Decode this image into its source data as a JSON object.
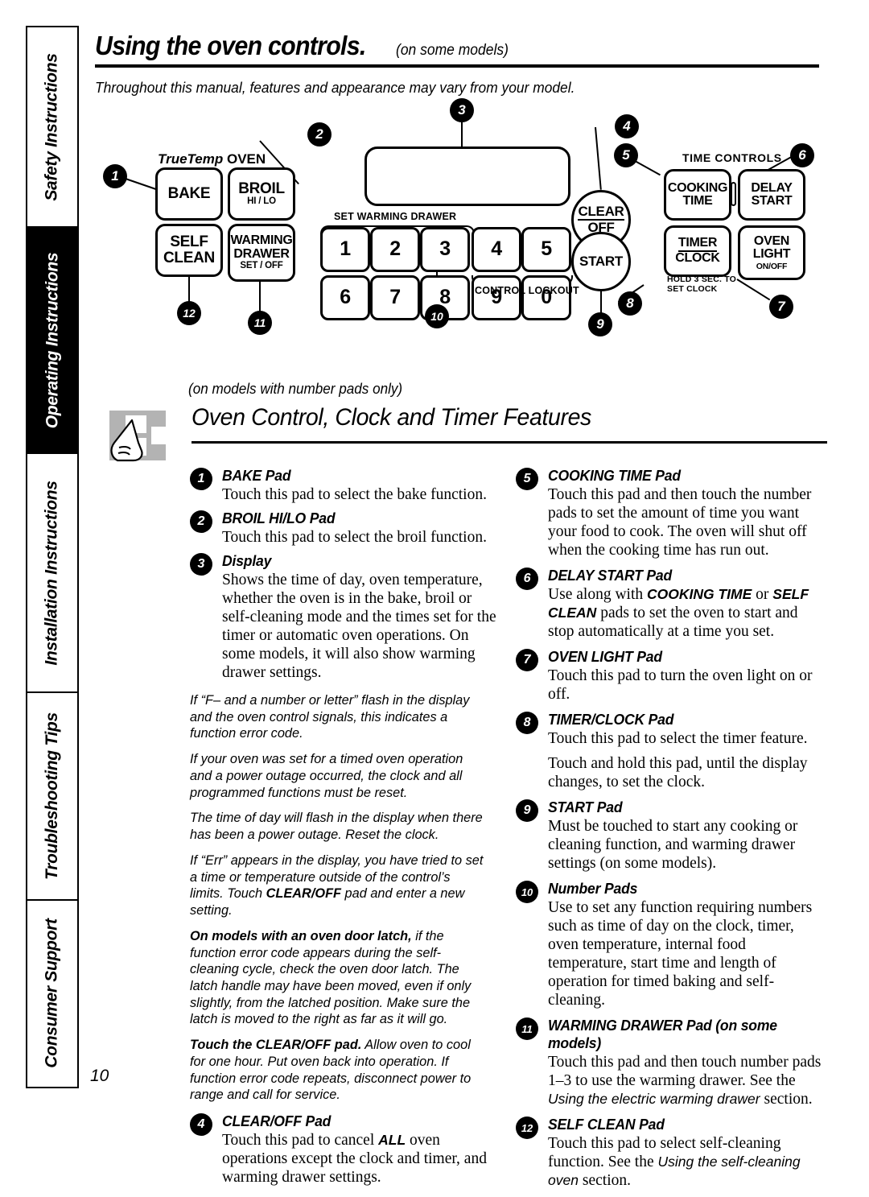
{
  "sidebar": {
    "tabs": [
      {
        "label": "Safety Instructions",
        "active": false,
        "flex": 1.55
      },
      {
        "label": "Operating Instructions",
        "active": true,
        "flex": 1.75
      },
      {
        "label": "Installation Instructions",
        "active": false,
        "flex": 1.85
      },
      {
        "label": "Troubleshooting Tips",
        "active": false,
        "flex": 1.6
      },
      {
        "label": "Consumer Support",
        "active": false,
        "flex": 1.45
      }
    ]
  },
  "header": {
    "title": "Using the oven controls.",
    "subtitle": "(on some models)",
    "intro": "Throughout this manual, features and appearance may vary from your model."
  },
  "diagram": {
    "brand_true_temp": "TrueTemp",
    "brand_oven": "OVEN",
    "set_warming_drawer_label": "SET WARMING DRAWER",
    "control_lockout_label": "CONTROL LOCKOUT",
    "time_controls_label": "TIME CONTROLS",
    "hold_clock_label_1": "HOLD 3 SEC. TO",
    "hold_clock_label_2": "SET CLOCK",
    "caption": "(on models with number pads only)",
    "pads": {
      "bake": "BAKE",
      "broil": "BROIL",
      "broil_sub": "HI / LO",
      "self": "SELF",
      "clean": "CLEAN",
      "warming": "WARMING",
      "drawer": "DRAWER",
      "drawer_sub": "SET / OFF",
      "clear": "CLEAR",
      "off": "OFF",
      "start": "START",
      "cooking": "COOKING",
      "time": "TIME",
      "delay": "DELAY",
      "delay_start": "START",
      "timer": "TIMER",
      "clock": "CLOCK",
      "oven": "OVEN",
      "light": "LIGHT",
      "light_sub": "ON/OFF"
    },
    "number_pads_row1": [
      "1",
      "2",
      "3",
      "4",
      "5"
    ],
    "number_pads_row2": [
      "6",
      "7",
      "8",
      "9",
      "0"
    ],
    "callouts": [
      "1",
      "2",
      "3",
      "4",
      "5",
      "6",
      "7",
      "8",
      "9",
      "10",
      "11",
      "12"
    ]
  },
  "section": {
    "title": "Oven Control, Clock and Timer Features"
  },
  "left_column": {
    "entries_top": [
      {
        "num": "1",
        "heading": "BAKE Pad",
        "body": [
          "Touch this pad to select the bake function."
        ]
      },
      {
        "num": "2",
        "heading": "BROIL HI/LO Pad",
        "body": [
          "Touch this pad to select the broil function."
        ]
      },
      {
        "num": "3",
        "heading": "Display",
        "body": [
          "Shows the time of day, oven temperature, whether the oven is in the bake, broil or self-cleaning mode and the times set for the timer or automatic oven operations. On some models, it will also show warming drawer settings."
        ]
      }
    ],
    "notes": [
      {
        "bold": "",
        "text": "If “F– and a number or letter” flash in the display and the oven control signals, this indicates a function error code."
      },
      {
        "bold": "",
        "text": "If your oven was set for a timed oven operation and a power outage occurred, the clock and all programmed functions must be reset."
      },
      {
        "bold": "",
        "text": "The time of day will flash in the display when there has been a power outage. Reset the clock."
      },
      {
        "bold": "",
        "text": "If “Err” appears in the display, you have tried to set a time or temperature outside of the control’s limits. Touch CLEAR/OFF pad and enter a new setting."
      },
      {
        "bold": "On models with an oven door latch,",
        "text": " if the function error code appears during the self-cleaning cycle, check the oven door latch. The latch handle may have been moved, even if only slightly, from the latched position. Make sure the latch is moved to the right as far as it will go."
      },
      {
        "bold": "Touch the CLEAR/OFF pad.",
        "text": " Allow oven to cool for one hour. Put oven back into operation. If function error code repeats, disconnect power to range and call for service."
      }
    ],
    "entry_bottom": {
      "num": "4",
      "heading": "CLEAR/OFF Pad",
      "body": "Touch this pad to cancel ALL oven operations except the clock and timer, and warming drawer settings."
    }
  },
  "right_column": {
    "entries": [
      {
        "num": "5",
        "heading": "COOKING TIME Pad",
        "body": [
          "Touch this pad and then touch the number pads to set the amount of time you want your food to cook. The oven will shut off when the cooking time has run out."
        ]
      },
      {
        "num": "6",
        "heading": "DELAY START Pad",
        "body": [
          "Use along with COOKING TIME or SELF CLEAN pads to set the oven to start and stop automatically at a time you set."
        ]
      },
      {
        "num": "7",
        "heading": "OVEN LIGHT Pad",
        "body": [
          "Touch this pad to turn the oven light on or off."
        ]
      },
      {
        "num": "8",
        "heading": "TIMER/CLOCK Pad",
        "body": [
          "Touch this pad to select the timer feature.",
          "Touch and hold this pad, until the display changes, to set the clock."
        ]
      },
      {
        "num": "9",
        "heading": "START Pad",
        "body": [
          "Must be touched to start any cooking or cleaning function, and warming drawer settings (on some models)."
        ]
      },
      {
        "num": "10",
        "heading": "Number Pads",
        "body": [
          "Use to set any function requiring numbers such as time of day on the clock, timer, oven temperature, internal food temperature, start time and length of operation for timed baking and self-cleaning."
        ]
      },
      {
        "num": "11",
        "heading": "WARMING DRAWER Pad (on some models)",
        "body": [
          "Touch this pad and then touch number pads 1–3 to use the warming drawer. See the Using the electric warming drawer section."
        ]
      },
      {
        "num": "12",
        "heading": "SELF CLEAN Pad",
        "body": [
          "Touch this pad to select self-cleaning function. See the Using the self-cleaning oven section."
        ]
      }
    ]
  },
  "footer": {
    "page_number": "10"
  },
  "colors": {
    "ink": "#000000",
    "paper": "#ffffff",
    "icon_gray": "#b3b3b3"
  }
}
